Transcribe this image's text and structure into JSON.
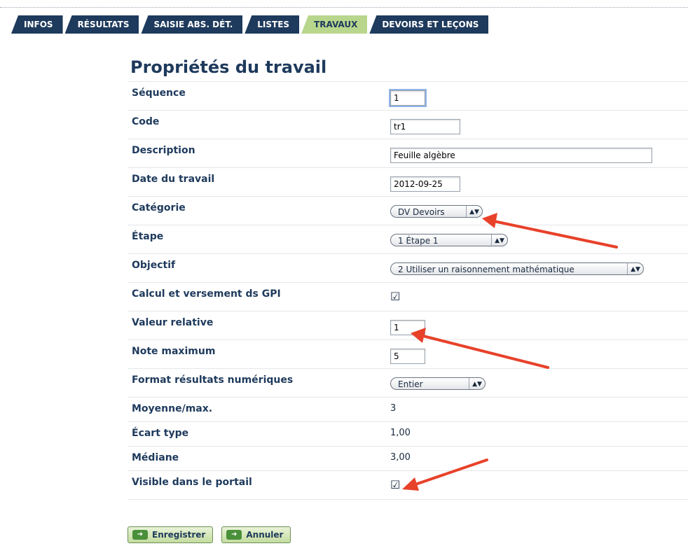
{
  "tabs": [
    "INFOS",
    "RÉSULTATS",
    "SAISIE ABS. DÉT.",
    "LISTES",
    "TRAVAUX",
    "DEVOIRS ET LEÇONS"
  ],
  "active_tab": "TRAVAUX",
  "title": "Propriétés du travail",
  "fields": {
    "sequence": {
      "label": "Séquence",
      "value": "1"
    },
    "code": {
      "label": "Code",
      "value": "tr1"
    },
    "description": {
      "label": "Description",
      "value": "Feuille algèbre"
    },
    "date": {
      "label": "Date du travail",
      "value": "2012-09-25"
    },
    "categorie": {
      "label": "Catégorie",
      "value": "DV Devoirs"
    },
    "etape": {
      "label": "Étape",
      "value": "1 Étape 1"
    },
    "objectif": {
      "label": "Objectif",
      "value": "2 Utiliser un raisonnement mathématique"
    },
    "calcul": {
      "label": "Calcul et versement ds GPI",
      "checked": true
    },
    "valeur": {
      "label": "Valeur relative",
      "value": "1"
    },
    "note_max": {
      "label": "Note maximum",
      "value": "5"
    },
    "format": {
      "label": "Format résultats numériques",
      "value": "Entier"
    },
    "moyenne": {
      "label": "Moyenne/max.",
      "value": "3"
    },
    "ecart": {
      "label": "Écart type",
      "value": "1,00"
    },
    "mediane": {
      "label": "Médiane",
      "value": "3,00"
    },
    "visible": {
      "label": "Visible dans le portail",
      "checked": true
    }
  },
  "buttons": {
    "save": "Enregistrer",
    "cancel": "Annuler"
  },
  "colors": {
    "nav": "#1e3a5c",
    "active_tab": "#b8d68c",
    "arrow": "#e8412a"
  },
  "icons": {
    "select_arrow": "up-down-arrows",
    "check": "checkbox-checked",
    "button": "green-arrow-icon"
  }
}
